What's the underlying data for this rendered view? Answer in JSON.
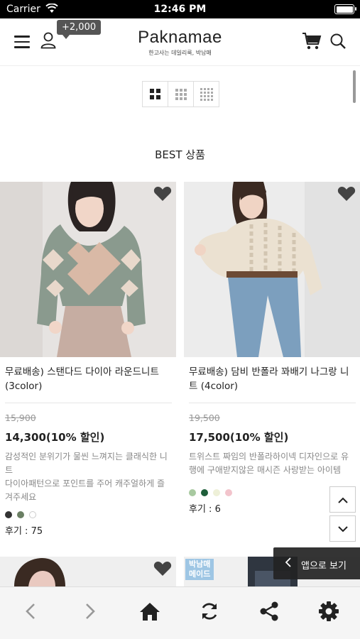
{
  "status_bar": {
    "carrier": "Carrier",
    "time": "12:46 PM",
    "battery_level": 1.0
  },
  "header": {
    "points_badge": "+2,000",
    "logo": "Paknamae",
    "tagline": "한고사는 데일리룩, 박남매"
  },
  "section_title": "BEST 상품",
  "products": [
    {
      "name": "무료배송) 스탠다드 다이아 라운드니트 (3color)",
      "original_price": "15,900",
      "sale_price": "14,300",
      "discount": "(10% 할인)",
      "description": "감성적인 분위기가 물씬 느껴지는 클래식한 니트\n다이아패턴으로 포인트를 주어 캐주얼하게 즐겨주세요",
      "colors": [
        "#333333",
        "#6a7f63",
        "#ffffff"
      ],
      "review": "후기 : 75"
    },
    {
      "name": "무료배송) 담비 반폴라 꽈배기 나그랑 니트 (4color)",
      "original_price": "19,500",
      "sale_price": "17,500",
      "discount": "(10% 할인)",
      "description": "트위스트 짜임의 반폴라하이넥 디자인으로 유행에 구애받지않은 매시즌 사랑받는 아이템",
      "colors": [
        "#a8c9a0",
        "#1e5e3a",
        "#eef0d8",
        "#f2c4cc"
      ],
      "review": "후기 : 6"
    }
  ],
  "peek_label": "박남매\n메이드",
  "app_banner": "앱으로 보기",
  "colors": {
    "accent": "#222222",
    "muted": "#888888",
    "strike": "#999999"
  }
}
